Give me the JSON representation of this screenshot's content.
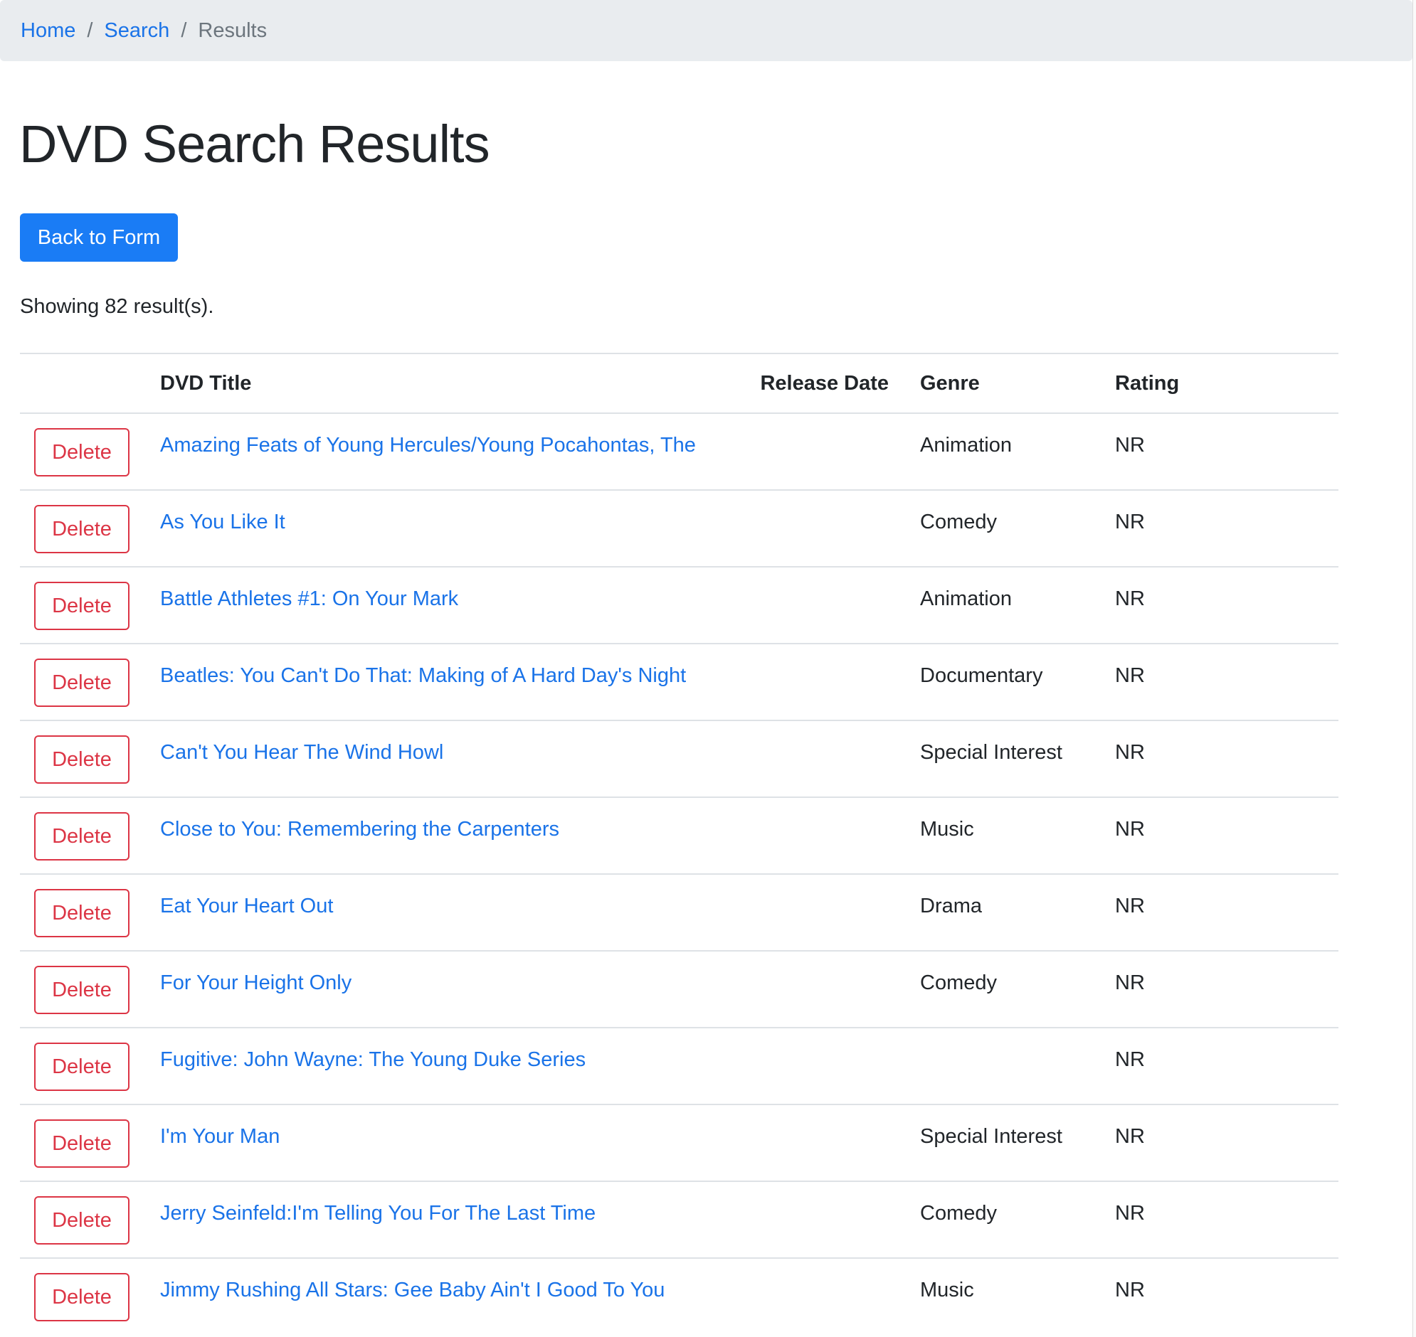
{
  "breadcrumb": {
    "items": [
      "Home",
      "Search"
    ],
    "active": "Results"
  },
  "page_title": "DVD Search Results",
  "back_button_label": "Back to Form",
  "result_count_text": "Showing 82 result(s).",
  "table": {
    "headers": [
      "",
      "DVD Title",
      "Release Date",
      "Genre",
      "Rating"
    ],
    "delete_label": "Delete",
    "rows": [
      {
        "title": "Amazing Feats of Young Hercules/Young Pocahontas, The",
        "release_date": "",
        "genre": "Animation",
        "rating": "NR"
      },
      {
        "title": "As You Like It",
        "release_date": "",
        "genre": "Comedy",
        "rating": "NR"
      },
      {
        "title": "Battle Athletes #1: On Your Mark",
        "release_date": "",
        "genre": "Animation",
        "rating": "NR"
      },
      {
        "title": "Beatles: You Can't Do That: Making of A Hard Day's Night",
        "release_date": "",
        "genre": "Documentary",
        "rating": "NR"
      },
      {
        "title": "Can't You Hear The Wind Howl",
        "release_date": "",
        "genre": "Special Interest",
        "rating": "NR"
      },
      {
        "title": "Close to You: Remembering the Carpenters",
        "release_date": "",
        "genre": "Music",
        "rating": "NR"
      },
      {
        "title": "Eat Your Heart Out",
        "release_date": "",
        "genre": "Drama",
        "rating": "NR"
      },
      {
        "title": "For Your Height Only",
        "release_date": "",
        "genre": "Comedy",
        "rating": "NR"
      },
      {
        "title": "Fugitive: John Wayne: The Young Duke Series",
        "release_date": "",
        "genre": "",
        "rating": "NR"
      },
      {
        "title": "I'm Your Man",
        "release_date": "",
        "genre": "Special Interest",
        "rating": "NR"
      },
      {
        "title": "Jerry Seinfeld:I'm Telling You For The Last Time",
        "release_date": "",
        "genre": "Comedy",
        "rating": "NR"
      },
      {
        "title": "Jimmy Rushing All Stars: Gee Baby Ain't I Good To You",
        "release_date": "",
        "genre": "Music",
        "rating": "NR"
      }
    ]
  },
  "colors": {
    "link": "#1a73e8",
    "primary_button": "#1a7cf5",
    "danger": "#dc3545",
    "breadcrumb_bg": "#e9ecef"
  }
}
